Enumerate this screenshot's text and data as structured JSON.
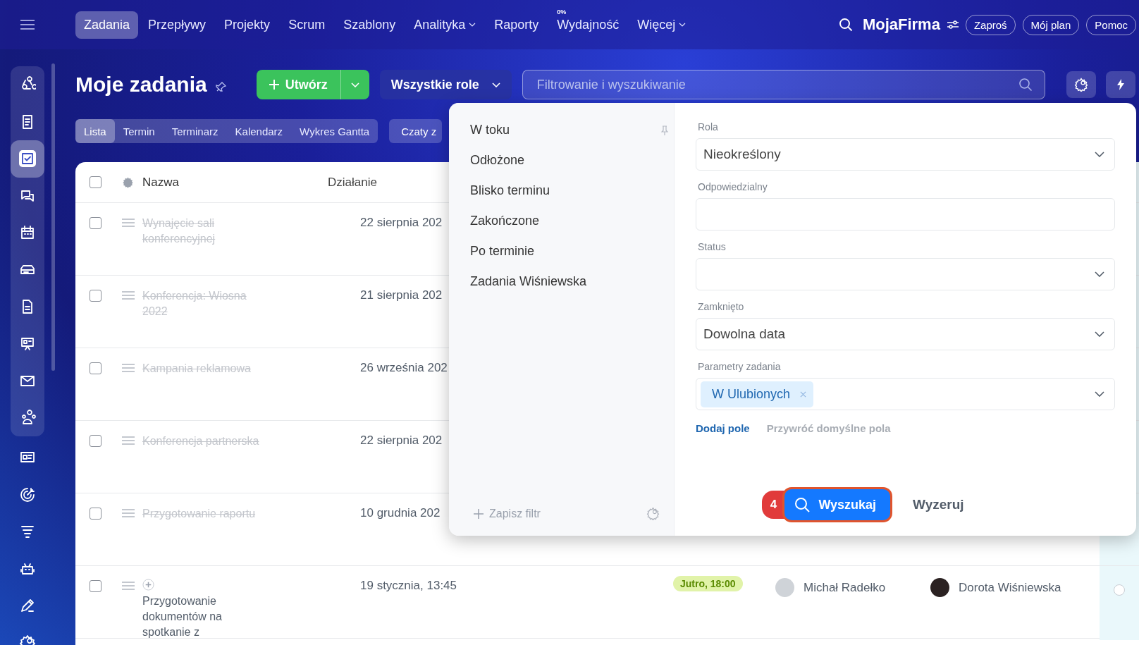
{
  "top_nav": {
    "items": [
      {
        "label": "Zadania",
        "selected": true,
        "dropdown": false
      },
      {
        "label": "Przepływy",
        "selected": false,
        "dropdown": false
      },
      {
        "label": "Projekty",
        "selected": false,
        "dropdown": false
      },
      {
        "label": "Scrum",
        "selected": false,
        "dropdown": false
      },
      {
        "label": "Szablony",
        "selected": false,
        "dropdown": false
      },
      {
        "label": "Analityka",
        "selected": false,
        "dropdown": true
      },
      {
        "label": "Raporty",
        "selected": false,
        "dropdown": false
      },
      {
        "label": "Wydajność",
        "selected": false,
        "dropdown": false,
        "badge": "0%"
      },
      {
        "label": "Więcej",
        "selected": false,
        "dropdown": true
      }
    ],
    "company": "MojaFirma",
    "buttons": [
      "Zaproś",
      "Mój plan",
      "Pomoc"
    ]
  },
  "sidebar": {
    "groups": [
      {
        "kind": "pinned",
        "items": [
          {
            "selected": false
          },
          {
            "selected": false
          },
          {
            "selected": true
          },
          {
            "selected": false
          },
          {
            "selected": false
          },
          {
            "selected": false
          },
          {
            "selected": false
          },
          {
            "selected": false
          },
          {
            "selected": false
          },
          {
            "selected": false
          }
        ]
      },
      {
        "kind": "plain",
        "items": [
          {
            "selected": false
          },
          {
            "selected": false
          },
          {
            "selected": false
          },
          {
            "selected": false
          },
          {
            "selected": false
          },
          {
            "selected": false
          }
        ]
      }
    ]
  },
  "header": {
    "title": "Moje zadania",
    "create_button": "Utwórz",
    "role_select": "Wszystkie role",
    "search": {
      "placeholder": "Filtrowanie i wyszukiwanie"
    }
  },
  "view_tabs": [
    {
      "label": "Lista",
      "selected": true
    },
    {
      "label": "Termin",
      "selected": false
    },
    {
      "label": "Terminarz",
      "selected": false
    },
    {
      "label": "Kalendarz",
      "selected": false
    },
    {
      "label": "Wykres Gantta",
      "selected": false
    }
  ],
  "chats_button": "Czaty z",
  "table": {
    "select_all_checked": false,
    "columns": [
      "Nazwa",
      "Działanie"
    ],
    "rows": [
      {
        "name": "Wynajęcie sali konferencyjnej",
        "done": true,
        "activity": "22 sierpnia 202",
        "checked": false
      },
      {
        "name": "Konferencja: Wiosna 2022",
        "done": true,
        "activity": "21 sierpnia 202",
        "checked": false
      },
      {
        "name": "Kampania reklamowa",
        "done": true,
        "activity": "26 września 202",
        "checked": false
      },
      {
        "name": "Konferencja partnerska",
        "done": true,
        "activity": "22 sierpnia 202",
        "checked": false
      },
      {
        "name": "Przygotowanie raportu",
        "done": true,
        "activity": "10 grudnia 202",
        "checked": false
      },
      {
        "name": "Przygotowanie dokumentów na spotkanie z",
        "done": false,
        "activity": "19 stycznia, 13:45",
        "checked": false,
        "deadline": "Jutro, 18:00",
        "responsible": "Michał Radełko",
        "creator": "Dorota Wiśniewska"
      }
    ]
  },
  "filter_popup": {
    "presets": [
      {
        "label": "W toku",
        "pinned": true
      },
      {
        "label": "Odłożone",
        "pinned": false
      },
      {
        "label": "Blisko terminu",
        "pinned": false
      },
      {
        "label": "Zakończone",
        "pinned": false
      },
      {
        "label": "Po terminie",
        "pinned": false
      },
      {
        "label": "Zadania Wiśniewska",
        "pinned": false
      }
    ],
    "save_filter": "Zapisz filtr",
    "fields": [
      {
        "label": "Rola",
        "kind": "select",
        "value": "Nieokreślony"
      },
      {
        "label": "Odpowiedzialny",
        "kind": "input"
      },
      {
        "label": "Status",
        "kind": "select"
      },
      {
        "label": "Zamknięto",
        "kind": "select",
        "value": "Dowolna data"
      },
      {
        "label": "Parametry zadania",
        "kind": "tags",
        "tags": [
          "W Ulubionych"
        ]
      }
    ],
    "add_field": "Dodaj pole",
    "restore_fields": "Przywróć domyślne pola",
    "step_badge": "4",
    "search_button": "Wyszukaj",
    "reset_button": "Wyzeruj"
  }
}
